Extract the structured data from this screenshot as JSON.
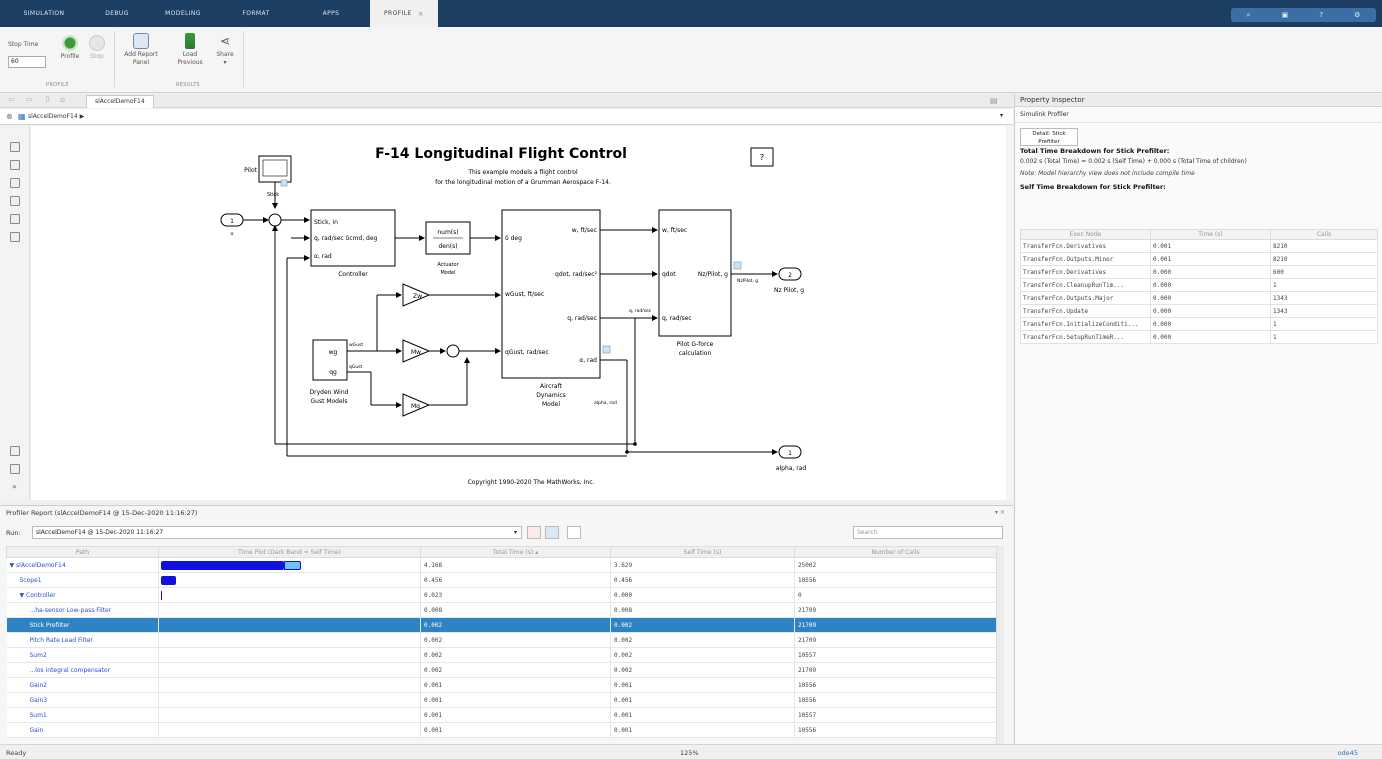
{
  "tabs": [
    {
      "label": "SIMULATION"
    },
    {
      "label": "DEBUG"
    },
    {
      "label": "MODELING"
    },
    {
      "label": "FORMAT"
    },
    {
      "label": "APPS"
    },
    {
      "label": "PROFILE",
      "active": true
    }
  ],
  "ribbon": {
    "stop_time_label": "Stop Time",
    "stop_time_value": "60",
    "profile_label": "Profile",
    "stop_label": "Stop",
    "add_report_panel_label": "Add Report Panel",
    "load_previous_label": "Load Previous",
    "share_label": "Share",
    "group_profile": "PROFILE",
    "group_results": "RESULTS"
  },
  "canvas": {
    "tab_label": "slAccelDemoF14",
    "breadcrumb": "slAccelDemoF14 ▶",
    "title": "F-14 Longitudinal Flight Control",
    "subtitle1": "This example models a flight control",
    "subtitle2": "for the longitudinal motion of a Grumman Aerospace F-14.",
    "copyright": "Copyright 1990-2020 The MathWorks, Inc.",
    "help_icon_label": "?",
    "blocks": {
      "pilot": "Pilot",
      "stick": "Stick",
      "in1": "1",
      "in1_sub": "u",
      "controller_in1": "Stick, in",
      "controller_in2": "q, rad/sec δcmd, deg",
      "controller_in3": "α, rad",
      "controller": "Controller",
      "actuator_num": "num(s)",
      "actuator_den": "den(s)",
      "actuator1": "Actuator",
      "actuator2": "Model",
      "delta_deg": "δ  deg",
      "zw": "Zw",
      "mw": "Mw",
      "mq": "Mq",
      "wg": "wg",
      "qg": "qg",
      "wgust": "wGust",
      "qgust": "qGust",
      "dryden1": "Dryden Wind",
      "dryden2": "Gust Models",
      "ac_w": "w, ft/sec",
      "ac_qdot": "qdot, rad/sec²",
      "ac_q": "q, rad/sec",
      "ac_alpha": "α, rad",
      "ac_wgust": "wGust, ft/sec",
      "ac_qgust": "qGust, rad/sec",
      "ac1": "Aircraft",
      "ac2": "Dynamics",
      "ac3": "Model",
      "q_rad": "q, rad/sec",
      "alpha_rad": "alpha, rad",
      "pg_w": "w, ft/sec",
      "pg_qdot": "qdot",
      "pg_q": "q, rad/sec",
      "pg_nz": "Nz/Pilot, g",
      "pg1": "Pilot G-force",
      "pg2": "calculation",
      "nzpilot_line": "NzPilot, g",
      "out2": "2",
      "out2_label": "Nz Pilot, g",
      "out1": "1",
      "out1_label": "alpha, rad"
    }
  },
  "inspector": {
    "title": "Property Inspector",
    "subtitle": "Simulink Profiler",
    "tab": "Detail: Stick Prefilter",
    "total_heading": "Total Time Breakdown for Stick Prefilter:",
    "total_line": "0.002 s (Total Time) = 0.002 s (Self Time) + 0.000 s (Total Time of children)",
    "note": "Note: Model hierarchy view does not include compile time",
    "self_heading": "Self Time Breakdown for Stick Prefilter:",
    "columns": [
      "Exec Node",
      "Time (s)",
      "Calls"
    ],
    "rows": [
      [
        "TransferFcn.Derivatives",
        "0.001",
        "8210"
      ],
      [
        "TransferFcn.Outputs.Minor",
        "0.001",
        "8210"
      ],
      [
        "TransferFcn.Derivatives",
        "0.000",
        "600"
      ],
      [
        "TransferFcn.CleanupRunTim...",
        "0.000",
        "1"
      ],
      [
        "TransferFcn.Outputs.Major",
        "0.000",
        "1343"
      ],
      [
        "TransferFcn.Update",
        "0.000",
        "1343"
      ],
      [
        "TransferFcn.InitializeConditi...",
        "0.000",
        "1"
      ],
      [
        "TransferFcn.SetupRunTimeR...",
        "0.000",
        "1"
      ]
    ]
  },
  "report": {
    "title": "Profiler Report (slAccelDemoF14 @ 15-Dec-2020 11:16:27)",
    "run_label": "Run:",
    "run_value": "slAccelDemoF14 @ 15-Dec-2020 11:16:27",
    "search_placeholder": "Search",
    "columns": [
      "Path",
      "Time Plot (Dark Band = Self Time)",
      "Total Time (s)",
      "Self Time (s)",
      "Number of Calls"
    ],
    "rows": [
      {
        "path": "▼ slAccelDemoF14",
        "total": "4.168",
        "self": "3.629",
        "calls": "25002",
        "total_frac": 0.56,
        "self_frac": 0.49,
        "indent": 0
      },
      {
        "path": "Scope1",
        "total": "0.456",
        "self": "0.456",
        "calls": "10556",
        "total_frac": 0.06,
        "self_frac": 0.06,
        "indent": 1
      },
      {
        "path": "▼ Controller",
        "total": "0.023",
        "self": "0.000",
        "calls": "0",
        "total_frac": 0.003,
        "self_frac": 0.0,
        "indent": 1
      },
      {
        "path": "...ha-sensor Low-pass Filter",
        "total": "0.008",
        "self": "0.008",
        "calls": "21709",
        "total_frac": 0.0,
        "self_frac": 0.0,
        "indent": 2
      },
      {
        "path": "Stick Prefilter",
        "total": "0.002",
        "self": "0.002",
        "calls": "21709",
        "total_frac": 0.0,
        "self_frac": 0.0,
        "indent": 2,
        "selected": true
      },
      {
        "path": "Pitch Rate Lead Filter",
        "total": "0.002",
        "self": "0.002",
        "calls": "21709",
        "total_frac": 0.0,
        "self_frac": 0.0,
        "indent": 2
      },
      {
        "path": "Sum2",
        "total": "0.002",
        "self": "0.002",
        "calls": "10557",
        "total_frac": 0.0,
        "self_frac": 0.0,
        "indent": 2
      },
      {
        "path": "...los integral compensator",
        "total": "0.002",
        "self": "0.002",
        "calls": "21709",
        "total_frac": 0.0,
        "self_frac": 0.0,
        "indent": 2
      },
      {
        "path": "Gain2",
        "total": "0.001",
        "self": "0.001",
        "calls": "10556",
        "total_frac": 0.0,
        "self_frac": 0.0,
        "indent": 2
      },
      {
        "path": "Gain3",
        "total": "0.001",
        "self": "0.001",
        "calls": "10556",
        "total_frac": 0.0,
        "self_frac": 0.0,
        "indent": 2
      },
      {
        "path": "Sum1",
        "total": "0.001",
        "self": "0.001",
        "calls": "10557",
        "total_frac": 0.0,
        "self_frac": 0.0,
        "indent": 2
      },
      {
        "path": "Gain",
        "total": "0.001",
        "self": "0.001",
        "calls": "10556",
        "total_frac": 0.0,
        "self_frac": 0.0,
        "indent": 2
      }
    ]
  },
  "status": {
    "left": "Ready",
    "center": "125%",
    "right": "ode45"
  },
  "colors": {
    "titlebar": "#1d3e63",
    "selection": "#2e83c5",
    "bar_self": "#1010e0",
    "bar_total": "#6ec5f4",
    "link": "#2c4cd8"
  }
}
